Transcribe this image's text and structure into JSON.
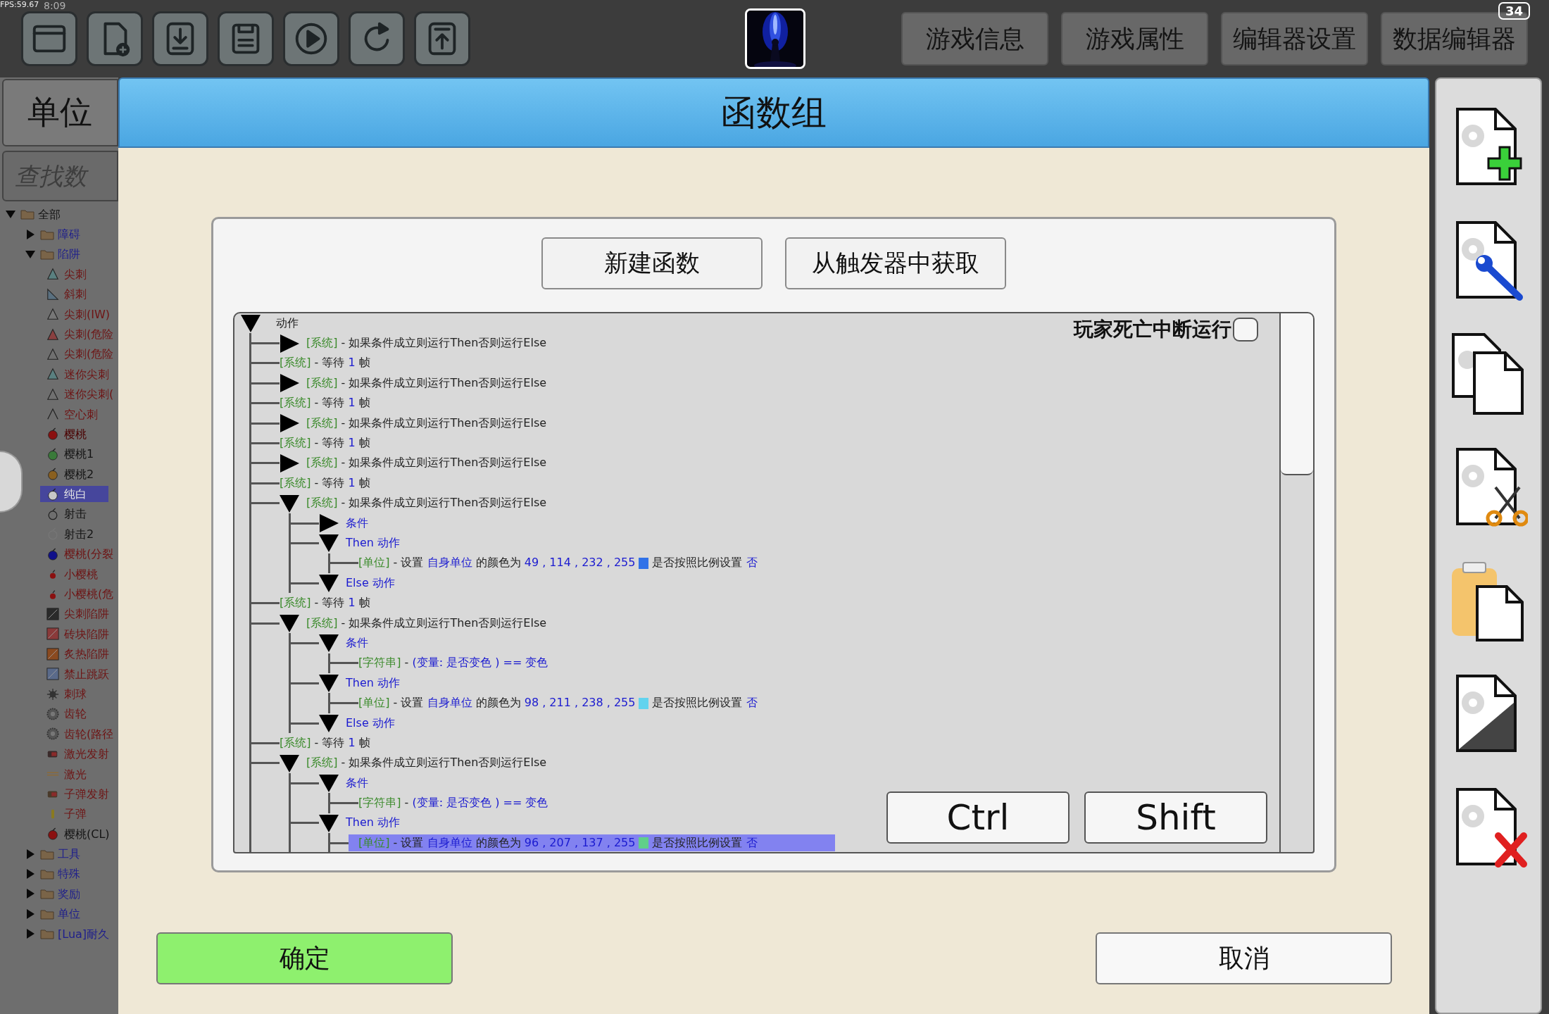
{
  "status_bar": {
    "fps": "FPS:59.67",
    "time": "8:09",
    "battery": "34"
  },
  "top_tabs": [
    "游戏信息",
    "游戏属性",
    "编辑器设置",
    "数据编辑器"
  ],
  "sidebar": {
    "title": "单位",
    "search": {
      "placeholder": "查找数"
    },
    "tree": [
      {
        "label": "全部",
        "kind": "folder",
        "expanded": true,
        "selected": false,
        "color": "#141414",
        "children": [
          {
            "label": "障碍",
            "kind": "folder",
            "expanded": false,
            "selected": false,
            "color": "#1e1e8c"
          },
          {
            "label": "陷阱",
            "kind": "folder",
            "expanded": true,
            "selected": false,
            "color": "#1e1e8c",
            "children": [
              {
                "label": "尖刺",
                "kind": "item",
                "selected": false,
                "color": "#6e1414"
              },
              {
                "label": "斜刺",
                "kind": "item",
                "selected": false,
                "color": "#6e1414"
              },
              {
                "label": "尖刺(IW)",
                "kind": "item",
                "selected": false,
                "color": "#6e1414"
              },
              {
                "label": "尖刺(危险",
                "kind": "item",
                "selected": false,
                "color": "#6e1414"
              },
              {
                "label": "尖刺(危险",
                "kind": "item",
                "selected": false,
                "color": "#6e1414"
              },
              {
                "label": "迷你尖刺",
                "kind": "item",
                "selected": false,
                "color": "#6e1414"
              },
              {
                "label": "迷你尖刺(",
                "kind": "item",
                "selected": false,
                "color": "#6e1414"
              },
              {
                "label": "空心刺",
                "kind": "item",
                "selected": false,
                "color": "#6e1414"
              },
              {
                "label": "樱桃",
                "kind": "item",
                "selected": false,
                "color": "#4a0000"
              },
              {
                "label": "樱桃1",
                "kind": "item",
                "selected": false,
                "color": "#141414"
              },
              {
                "label": "樱桃2",
                "kind": "item",
                "selected": false,
                "color": "#141414"
              },
              {
                "label": "纯白",
                "kind": "item",
                "selected": true,
                "color": "#e6e6e6"
              },
              {
                "label": "射击",
                "kind": "item",
                "selected": false,
                "color": "#141414"
              },
              {
                "label": "射击2",
                "kind": "item",
                "selected": false,
                "color": "#141414"
              },
              {
                "label": "樱桃(分裂",
                "kind": "item",
                "selected": false,
                "color": "#6e1414"
              },
              {
                "label": "小樱桃",
                "kind": "item",
                "selected": false,
                "color": "#6e1414"
              },
              {
                "label": "小樱桃(危",
                "kind": "item",
                "selected": false,
                "color": "#6e1414"
              },
              {
                "label": "尖刺陷阱",
                "kind": "item",
                "selected": false,
                "color": "#6e1414"
              },
              {
                "label": "砖块陷阱",
                "kind": "item",
                "selected": false,
                "color": "#6e1414"
              },
              {
                "label": "炙热陷阱",
                "kind": "item",
                "selected": false,
                "color": "#6e1414"
              },
              {
                "label": "禁止跳跃",
                "kind": "item",
                "selected": false,
                "color": "#6e1414"
              },
              {
                "label": "刺球",
                "kind": "item",
                "selected": false,
                "color": "#6e1414"
              },
              {
                "label": "齿轮",
                "kind": "item",
                "selected": false,
                "color": "#6e1414"
              },
              {
                "label": "齿轮(路径",
                "kind": "item",
                "selected": false,
                "color": "#6e1414"
              },
              {
                "label": "激光发射",
                "kind": "item",
                "selected": false,
                "color": "#6e1414"
              },
              {
                "label": "激光",
                "kind": "item",
                "selected": false,
                "color": "#6e1414"
              },
              {
                "label": "子弹发射",
                "kind": "item",
                "selected": false,
                "color": "#6e1414"
              },
              {
                "label": "子弹",
                "kind": "item",
                "selected": false,
                "color": "#6e1414"
              },
              {
                "label": "樱桃(CL)",
                "kind": "item",
                "selected": false,
                "color": "#141414"
              }
            ]
          },
          {
            "label": "工具",
            "kind": "folder",
            "expanded": false,
            "selected": false,
            "color": "#1e1e8c"
          },
          {
            "label": "特殊",
            "kind": "folder",
            "expanded": false,
            "selected": false,
            "color": "#1e1e8c"
          },
          {
            "label": "奖励",
            "kind": "folder",
            "expanded": false,
            "selected": false,
            "color": "#1e1e8c"
          },
          {
            "label": "单位",
            "kind": "folder",
            "expanded": false,
            "selected": false,
            "color": "#1e1e8c"
          },
          {
            "label": "[Lua]耐久",
            "kind": "folder",
            "expanded": false,
            "selected": false,
            "color": "#1e1e8c"
          }
        ]
      }
    ]
  },
  "dialog": {
    "title": "函数组",
    "buttons": [
      "新建函数",
      "从触发器中获取"
    ],
    "option": {
      "label": "玩家死亡中断运行",
      "checked": false
    },
    "tree": {
      "kind": "group",
      "expanded": true,
      "selected": false,
      "parts": [
        {
          "kind": "text",
          "text": "动作"
        }
      ],
      "children": [
        {
          "kind": "group",
          "expanded": false,
          "selected": false,
          "parts": [
            {
              "kind": "tag",
              "text": "[系统]"
            },
            {
              "kind": "text",
              "text": "- 如果条件成立则运行Then否则运行Else"
            }
          ]
        },
        {
          "kind": "leaf",
          "selected": false,
          "parts": [
            {
              "kind": "tag",
              "text": "[系统]"
            },
            {
              "kind": "text",
              "text": "- 等待"
            },
            {
              "kind": "value",
              "text": "1"
            },
            {
              "kind": "text",
              "text": "帧"
            }
          ]
        },
        {
          "kind": "group",
          "expanded": false,
          "selected": false,
          "parts": [
            {
              "kind": "tag",
              "text": "[系统]"
            },
            {
              "kind": "text",
              "text": "- 如果条件成立则运行Then否则运行Else"
            }
          ]
        },
        {
          "kind": "leaf",
          "selected": false,
          "parts": [
            {
              "kind": "tag",
              "text": "[系统]"
            },
            {
              "kind": "text",
              "text": "- 等待"
            },
            {
              "kind": "value",
              "text": "1"
            },
            {
              "kind": "text",
              "text": "帧"
            }
          ]
        },
        {
          "kind": "group",
          "expanded": false,
          "selected": false,
          "parts": [
            {
              "kind": "tag",
              "text": "[系统]"
            },
            {
              "kind": "text",
              "text": "- 如果条件成立则运行Then否则运行Else"
            }
          ]
        },
        {
          "kind": "leaf",
          "selected": false,
          "parts": [
            {
              "kind": "tag",
              "text": "[系统]"
            },
            {
              "kind": "text",
              "text": "- 等待"
            },
            {
              "kind": "value",
              "text": "1"
            },
            {
              "kind": "text",
              "text": "帧"
            }
          ]
        },
        {
          "kind": "group",
          "expanded": false,
          "selected": false,
          "parts": [
            {
              "kind": "tag",
              "text": "[系统]"
            },
            {
              "kind": "text",
              "text": "- 如果条件成立则运行Then否则运行Else"
            }
          ]
        },
        {
          "kind": "leaf",
          "selected": false,
          "parts": [
            {
              "kind": "tag",
              "text": "[系统]"
            },
            {
              "kind": "text",
              "text": "- 等待"
            },
            {
              "kind": "value",
              "text": "1"
            },
            {
              "kind": "text",
              "text": "帧"
            }
          ]
        },
        {
          "kind": "group",
          "expanded": true,
          "selected": false,
          "parts": [
            {
              "kind": "tag",
              "text": "[系统]"
            },
            {
              "kind": "text",
              "text": "- 如果条件成立则运行Then否则运行Else"
            }
          ],
          "children": [
            {
              "kind": "group",
              "expanded": false,
              "selected": false,
              "parts": [
                {
                  "kind": "value",
                  "text": "条件"
                }
              ]
            },
            {
              "kind": "group",
              "expanded": true,
              "selected": false,
              "parts": [
                {
                  "kind": "value",
                  "text": "Then 动作"
                }
              ],
              "children": [
                {
                  "kind": "leaf",
                  "selected": false,
                  "parts": [
                    {
                      "kind": "tag",
                      "text": "[单位]"
                    },
                    {
                      "kind": "text",
                      "text": "- 设置"
                    },
                    {
                      "kind": "value",
                      "text": "自身单位"
                    },
                    {
                      "kind": "text",
                      "text": "的颜色为"
                    },
                    {
                      "kind": "value",
                      "text": "49 , 114 , 232 , 255"
                    },
                    {
                      "kind": "swatch",
                      "color": "#3172e8"
                    },
                    {
                      "kind": "text",
                      "text": "是否按照比例设置"
                    },
                    {
                      "kind": "value",
                      "text": "否"
                    }
                  ]
                }
              ]
            },
            {
              "kind": "group",
              "expanded": true,
              "selected": false,
              "parts": [
                {
                  "kind": "value",
                  "text": "Else 动作"
                }
              ]
            }
          ]
        },
        {
          "kind": "leaf",
          "selected": false,
          "parts": [
            {
              "kind": "tag",
              "text": "[系统]"
            },
            {
              "kind": "text",
              "text": "- 等待"
            },
            {
              "kind": "value",
              "text": "1"
            },
            {
              "kind": "text",
              "text": "帧"
            }
          ]
        },
        {
          "kind": "group",
          "expanded": true,
          "selected": false,
          "parts": [
            {
              "kind": "tag",
              "text": "[系统]"
            },
            {
              "kind": "text",
              "text": "- 如果条件成立则运行Then否则运行Else"
            }
          ],
          "children": [
            {
              "kind": "group",
              "expanded": true,
              "selected": false,
              "parts": [
                {
                  "kind": "value",
                  "text": "条件"
                }
              ],
              "children": [
                {
                  "kind": "leaf",
                  "selected": false,
                  "parts": [
                    {
                      "kind": "tag",
                      "text": "[字符串]"
                    },
                    {
                      "kind": "text",
                      "text": "-"
                    },
                    {
                      "kind": "value",
                      "text": "(变量: 是否变色 ) == 变色"
                    }
                  ]
                }
              ]
            },
            {
              "kind": "group",
              "expanded": true,
              "selected": false,
              "parts": [
                {
                  "kind": "value",
                  "text": "Then 动作"
                }
              ],
              "children": [
                {
                  "kind": "leaf",
                  "selected": false,
                  "parts": [
                    {
                      "kind": "tag",
                      "text": "[单位]"
                    },
                    {
                      "kind": "text",
                      "text": "- 设置"
                    },
                    {
                      "kind": "value",
                      "text": "自身单位"
                    },
                    {
                      "kind": "text",
                      "text": "的颜色为"
                    },
                    {
                      "kind": "value",
                      "text": "98 , 211 , 238 , 255"
                    },
                    {
                      "kind": "swatch",
                      "color": "#62d3ee"
                    },
                    {
                      "kind": "text",
                      "text": "是否按照比例设置"
                    },
                    {
                      "kind": "value",
                      "text": "否"
                    }
                  ]
                }
              ]
            },
            {
              "kind": "group",
              "expanded": true,
              "selected": false,
              "parts": [
                {
                  "kind": "value",
                  "text": "Else 动作"
                }
              ]
            }
          ]
        },
        {
          "kind": "leaf",
          "selected": false,
          "parts": [
            {
              "kind": "tag",
              "text": "[系统]"
            },
            {
              "kind": "text",
              "text": "- 等待"
            },
            {
              "kind": "value",
              "text": "1"
            },
            {
              "kind": "text",
              "text": "帧"
            }
          ]
        },
        {
          "kind": "group",
          "expanded": true,
          "selected": false,
          "parts": [
            {
              "kind": "tag",
              "text": "[系统]"
            },
            {
              "kind": "text",
              "text": "- 如果条件成立则运行Then否则运行Else"
            }
          ],
          "children": [
            {
              "kind": "group",
              "expanded": true,
              "selected": false,
              "parts": [
                {
                  "kind": "value",
                  "text": "条件"
                }
              ],
              "children": [
                {
                  "kind": "leaf",
                  "selected": false,
                  "parts": [
                    {
                      "kind": "tag",
                      "text": "[字符串]"
                    },
                    {
                      "kind": "text",
                      "text": "-"
                    },
                    {
                      "kind": "value",
                      "text": "(变量: 是否变色 ) == 变色"
                    }
                  ]
                }
              ]
            },
            {
              "kind": "group",
              "expanded": true,
              "selected": false,
              "parts": [
                {
                  "kind": "value",
                  "text": "Then 动作"
                }
              ],
              "children": [
                {
                  "kind": "leaf",
                  "selected": true,
                  "parts": [
                    {
                      "kind": "tag",
                      "text": "[单位]"
                    },
                    {
                      "kind": "text",
                      "text": "- 设置"
                    },
                    {
                      "kind": "value",
                      "text": "自身单位"
                    },
                    {
                      "kind": "text",
                      "text": "的颜色为"
                    },
                    {
                      "kind": "value",
                      "text": "96 , 207 , 137 , 255"
                    },
                    {
                      "kind": "swatch",
                      "color": "#60cf89"
                    },
                    {
                      "kind": "text",
                      "text": "是否按照比例设置"
                    },
                    {
                      "kind": "value",
                      "text": "否"
                    }
                  ]
                }
              ]
            }
          ]
        }
      ]
    },
    "keys": [
      "Ctrl",
      "Shift"
    ],
    "confirm": "确定",
    "cancel": "取消"
  }
}
